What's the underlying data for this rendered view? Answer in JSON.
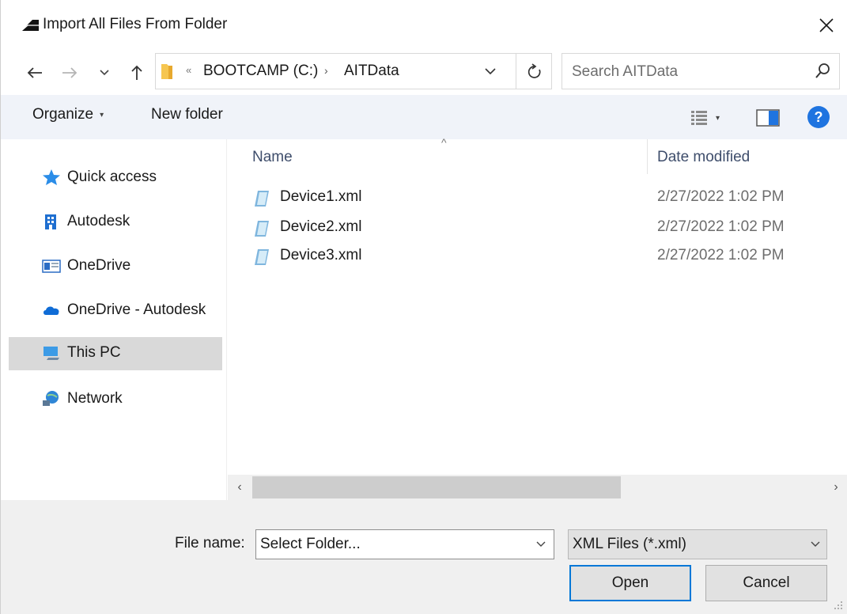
{
  "window": {
    "title": "Import All Files From Folder",
    "close_icon": "close-icon"
  },
  "nav": {
    "breadcrumb": {
      "overflow": "«",
      "drive": "BOOTCAMP (C:)",
      "separator": "›",
      "folder": "AITData"
    },
    "search_placeholder": "Search AITData"
  },
  "toolbar": {
    "organize_label": "Organize",
    "new_folder_label": "New folder",
    "help_label": "?"
  },
  "sidebar": {
    "items": [
      {
        "label": "Quick access",
        "icon": "star-icon"
      },
      {
        "label": "Autodesk",
        "icon": "building-icon"
      },
      {
        "label": "OneDrive",
        "icon": "onedrive-window-icon"
      },
      {
        "label": "OneDrive - Autodesk",
        "icon": "cloud-icon"
      },
      {
        "label": "This PC",
        "icon": "computer-icon",
        "selected": true
      },
      {
        "label": "Network",
        "icon": "network-icon"
      }
    ]
  },
  "files": {
    "columns": [
      "Name",
      "Date modified"
    ],
    "rows": [
      {
        "name": "Device1.xml",
        "date": "2/27/2022 1:02 PM"
      },
      {
        "name": "Device2.xml",
        "date": "2/27/2022 1:02 PM"
      },
      {
        "name": "Device3.xml",
        "date": "2/27/2022 1:02 PM"
      }
    ]
  },
  "footer": {
    "file_name_label": "File name:",
    "file_name_value": "Select Folder...",
    "file_type_value": "XML Files (*.xml)",
    "open_label": "Open",
    "cancel_label": "Cancel"
  },
  "colors": {
    "accent": "#0078d7",
    "toolbar_bg": "#f0f3f9",
    "selected_bg": "#d9d9d9",
    "help_blue": "#1f74e0"
  }
}
